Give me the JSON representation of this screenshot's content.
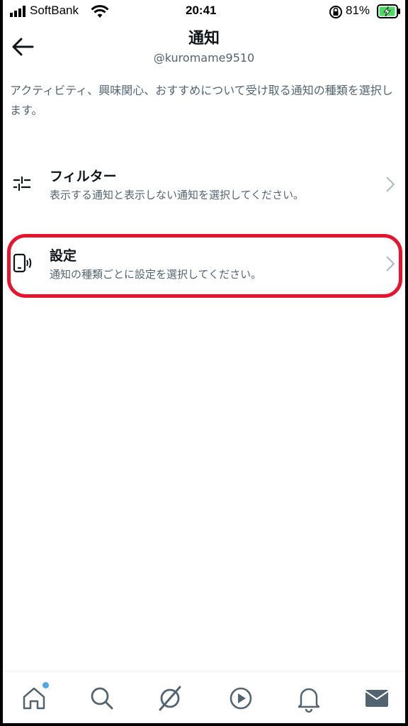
{
  "status_bar": {
    "carrier": "SoftBank",
    "time": "20:41",
    "battery": "81%",
    "signal_icon": "signal-bars-icon",
    "wifi_icon": "wifi-icon",
    "lock_icon": "orientation-lock-icon",
    "battery_icon": "battery-charging-icon"
  },
  "header": {
    "title": "通知",
    "subtitle": "@kuromame9510",
    "back_icon": "arrow-left-icon"
  },
  "description": "アクティビティ、興味関心、おすすめについて受け取る通知の種類を選択します。",
  "menu": [
    {
      "title": "フィルター",
      "description": "表示する通知と表示しない通知を選択してください。",
      "icon": "sliders-icon"
    },
    {
      "title": "設定",
      "description": "通知の種類ごとに設定を選択してください。",
      "icon": "phone-vibrate-icon"
    }
  ],
  "highlight": {
    "color": "#e8142d",
    "target": "設定"
  },
  "bottom_nav": [
    {
      "icon": "home-icon",
      "badge": true
    },
    {
      "icon": "search-icon"
    },
    {
      "icon": "spaces-icon"
    },
    {
      "icon": "video-play-icon"
    },
    {
      "icon": "bell-icon"
    },
    {
      "icon": "mail-icon"
    }
  ],
  "colors": {
    "text_primary": "#0f1419",
    "text_secondary": "#536471",
    "badge": "#4da6e8",
    "highlight": "#e8142d"
  }
}
